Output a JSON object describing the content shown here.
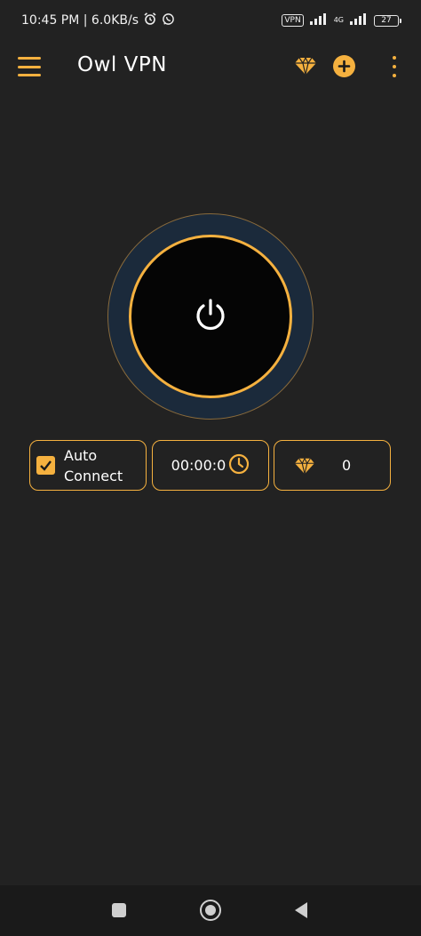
{
  "status_bar": {
    "time_speed": "10:45 PM | 6.0KB/s",
    "vpn_badge": "VPN",
    "network_type": "4G",
    "battery_level": "27"
  },
  "app_bar": {
    "title": "Owl VPN"
  },
  "cards": {
    "auto_connect_line1": "Auto",
    "auto_connect_line2": "Connect",
    "auto_connect_checked": true,
    "timer": "00:00:0",
    "gem_count": "0"
  },
  "colors": {
    "accent": "#f5b13f",
    "background": "#222222",
    "ring": "#1b2a3b"
  },
  "icons": {
    "menu": "hamburger-icon",
    "gem": "diamond-icon",
    "add": "plus-icon",
    "more": "more-vertical-icon",
    "power": "power-icon",
    "clock": "clock-icon",
    "check": "checkmark-icon"
  }
}
